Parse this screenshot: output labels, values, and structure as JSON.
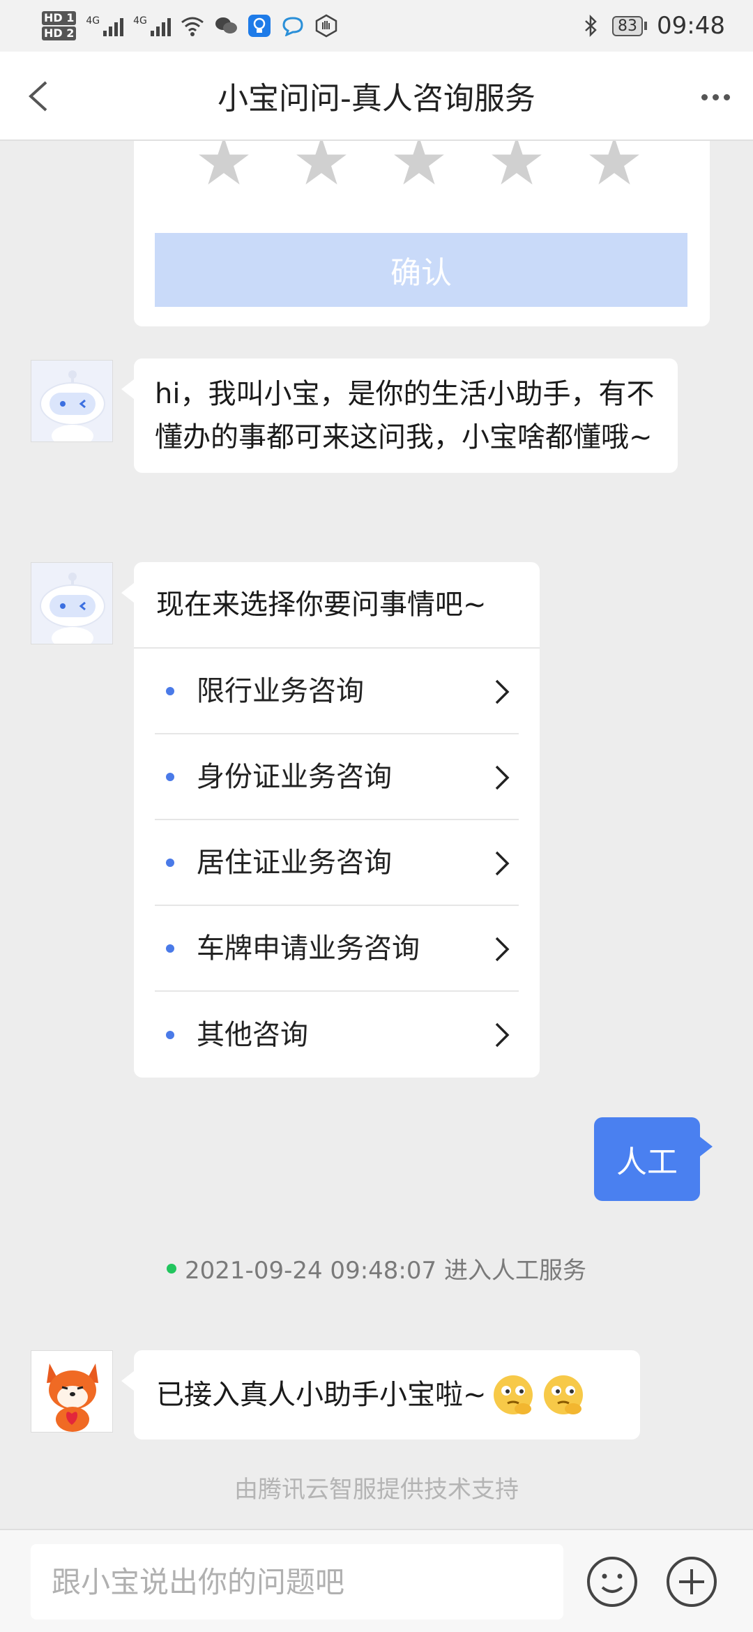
{
  "status_bar": {
    "sim1": "HD 1",
    "sim2": "HD 2",
    "network1": "4G",
    "network2": "4G",
    "battery": "83",
    "time": "09:48",
    "icons": [
      "wifi-icon",
      "wechat-icon",
      "bulb-app-icon",
      "chat-app-icon",
      "hand-icon",
      "bluetooth-icon"
    ]
  },
  "nav": {
    "title": "小宝问问-真人咨询服务",
    "back_icon": "chevron-left-icon",
    "more_icon": "more-dots-icon"
  },
  "rating": {
    "star_count": 5,
    "confirm_label": "确认",
    "colors": {
      "star": "#d0d0d0",
      "confirm_bg": "#c9daf9"
    }
  },
  "messages": {
    "greeting": "hi，我叫小宝，是你的生活小助手，有不懂办的事都可来这问我，小宝啥都懂哦~",
    "menu": {
      "prompt": "现在来选择你要问事情吧~",
      "items": [
        "限行业务咨询",
        "身份证业务咨询",
        "居住证业务咨询",
        "车牌申请业务咨询",
        "其他咨询"
      ]
    },
    "user_reply": "人工",
    "system_notice": "2021-09-24 09:48:07 进入人工服务",
    "agent_reply": "已接入真人小助手小宝啦~"
  },
  "footer_note": "由腾讯云智服提供技术支持",
  "input": {
    "placeholder": "跟小宝说出你的问题吧",
    "emoji_icon": "smiley-icon",
    "plus_icon": "plus-circle-icon"
  },
  "colors": {
    "accent": "#4a80f0",
    "menu_dot": "#4a7ae8",
    "online_dot": "#22c55e",
    "background": "#ededed"
  }
}
